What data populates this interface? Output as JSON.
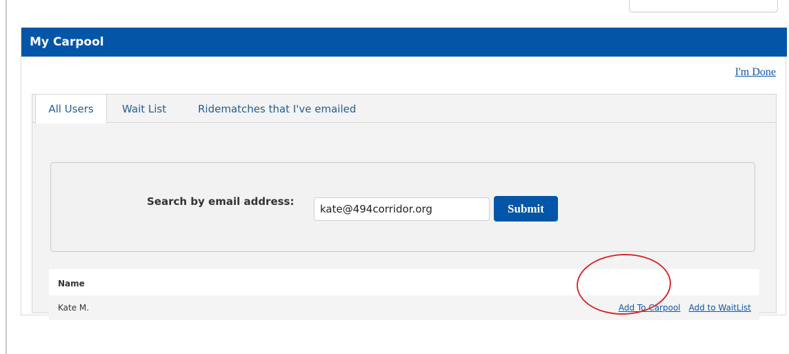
{
  "panel": {
    "title": "My Carpool",
    "done_link": "I'm Done"
  },
  "tabs": [
    {
      "label": "All Users",
      "active": true
    },
    {
      "label": "Wait List",
      "active": false
    },
    {
      "label": "Ridematches that I've emailed",
      "active": false
    }
  ],
  "search": {
    "label": "Search by email address:",
    "value": "kate@494corridor.org",
    "submit_label": "Submit"
  },
  "results": {
    "header": "Name",
    "rows": [
      {
        "name": "Kate M.",
        "actions": [
          "Add To Carpool",
          "Add to WaitList"
        ]
      }
    ]
  },
  "colors": {
    "header_blue": "#0356a7",
    "link_blue": "#0c54a8",
    "annotation_red": "#d72b2b"
  }
}
